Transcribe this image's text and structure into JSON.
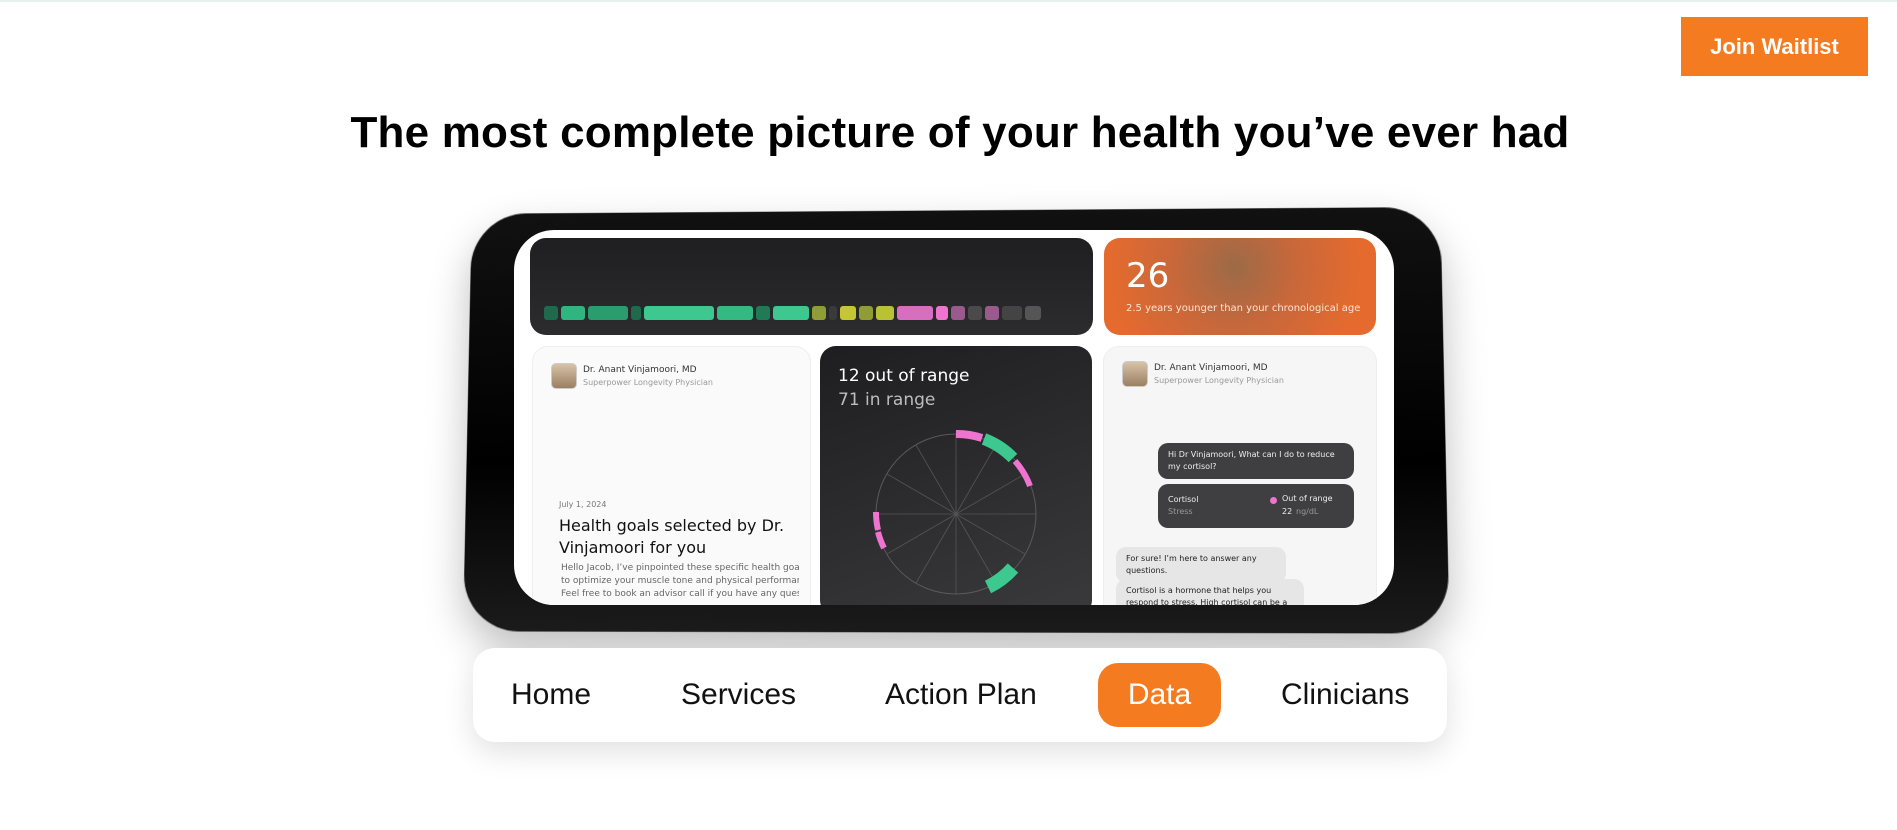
{
  "header": {
    "join_label": "Join Waitlist"
  },
  "hero": {
    "headline": "The most complete picture of your health you’ve ever had"
  },
  "device": {
    "age": {
      "value": "26",
      "caption": "2.5 years younger than your chronological age"
    },
    "goals_card": {
      "doctor_name": "Dr. Anant Vinjamoori, MD",
      "doctor_role": "Superpower Longevity Physician",
      "date": "July 1, 2024",
      "title": "Health goals selected by Dr. Vinjamoori for you",
      "body_lines": [
        "Hello Jacob, I’ve pinpointed these specific health goals",
        "to optimize your muscle tone and physical performance.",
        "Feel free to book an advisor call if you have any questio..."
      ]
    },
    "range_card": {
      "out_of_range": "12 out of range",
      "in_range": "71 in range"
    },
    "chat_card": {
      "doctor_name": "Dr. Anant Vinjamoori, MD",
      "doctor_role": "Superpower Longevity Physician",
      "question": "Hi Dr Vinjamoori, What can I do to reduce my cortisol?",
      "marker": {
        "name": "Cortisol",
        "category": "Stress",
        "status": "Out of range",
        "value": "22",
        "unit": "ng/dL"
      },
      "reply1": "For sure! I’m here to answer any questions.",
      "reply2": "Cortisol is a hormone that helps you respond to stress. High cortisol can be a sign of too much"
    }
  },
  "nav": {
    "items": [
      {
        "label": "Home"
      },
      {
        "label": "Services"
      },
      {
        "label": "Action Plan"
      },
      {
        "label": "Data"
      },
      {
        "label": "Clinicians"
      }
    ],
    "active_index": 3
  },
  "colors": {
    "accent": "#f47b20",
    "in_range": "#3cc88f",
    "out_of_range": "#ee74d0",
    "borderline": "#c4c634"
  }
}
